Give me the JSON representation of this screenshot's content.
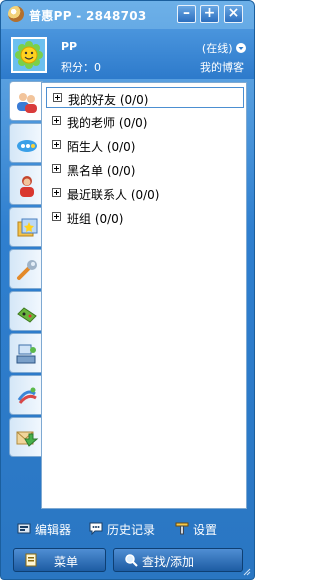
{
  "window": {
    "title": "普惠PP - 2848703"
  },
  "titlebar_buttons": {
    "minimize": "–",
    "maximize": "+",
    "close": "×"
  },
  "profile": {
    "nickname": "PP",
    "points_label": "积分：0",
    "status": "(在线)",
    "blog_link": "我的博客"
  },
  "side_tabs": [
    "contacts",
    "chat",
    "person",
    "star-card",
    "tools",
    "games",
    "desktop",
    "mobile",
    "mail"
  ],
  "groups": [
    {
      "label": "我的好友 (0/0)",
      "selected": true
    },
    {
      "label": "我的老师 (0/0)",
      "selected": false
    },
    {
      "label": "陌生人 (0/0)",
      "selected": false
    },
    {
      "label": "黑名单 (0/0)",
      "selected": false
    },
    {
      "label": "最近联系人 (0/0)",
      "selected": false
    },
    {
      "label": "班组 (0/0)",
      "selected": false
    }
  ],
  "toolbar": {
    "editor": "编辑器",
    "history": "历史记录",
    "settings": "设置"
  },
  "buttons": {
    "menu": "菜单",
    "find_add": "查找/添加"
  },
  "colors": {
    "titlebar": "#2f7fcf",
    "panel_border": "#7ea9d2",
    "button": "#1d5ca3"
  }
}
